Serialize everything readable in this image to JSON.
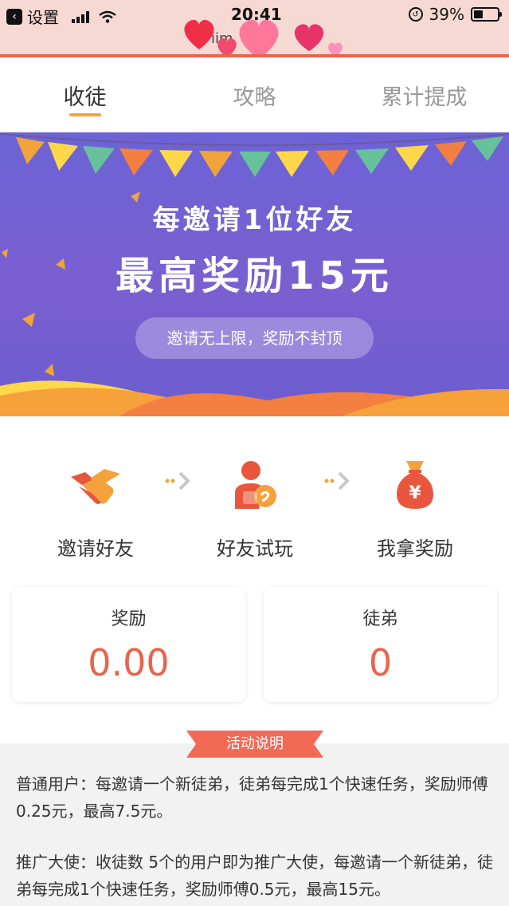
{
  "status_bar": {
    "back_label": "设置",
    "time": "20:41",
    "battery_text": "39%",
    "battery_level": 0.39,
    "icons": [
      "back-icon",
      "signal-icon",
      "wifi-icon",
      "orientation-lock-icon",
      "battery-icon"
    ]
  },
  "url_strip": {
    "url_fragment": "iim"
  },
  "tabs": [
    {
      "label": "收徒",
      "active": true
    },
    {
      "label": "攻略",
      "active": false
    },
    {
      "label": "累计提成",
      "active": false
    }
  ],
  "banner": {
    "line1": "每邀请1位好友",
    "line2": "最高奖励15元",
    "pill": "邀请无上限，奖励不封顶"
  },
  "steps": [
    {
      "label": "邀请好友",
      "icon": "handshake-icon"
    },
    {
      "label": "好友试玩",
      "icon": "user-play-icon"
    },
    {
      "label": "我拿奖励",
      "icon": "money-bag-icon"
    }
  ],
  "stats": {
    "reward": {
      "title": "奖励",
      "value": "0.00"
    },
    "apprentices": {
      "title": "徒弟",
      "value": "0"
    }
  },
  "info": {
    "ribbon": "活动说明",
    "para1": "普通用户：每邀请一个新徒弟，徒弟每完成1个快速任务，奖励师傅0.25元，最高7.5元。",
    "para2": "推广大使：收徒数 5个的用户即为推广大使，每邀请一个新徒弟，徒弟每完成1个快速任务，奖励师傅0.5元，最高15元。"
  },
  "colors": {
    "accent_orange": "#f0a43a",
    "stat_red": "#e8654d",
    "banner_purple": "#6c63d6",
    "ribbon_red": "#f26a55"
  }
}
